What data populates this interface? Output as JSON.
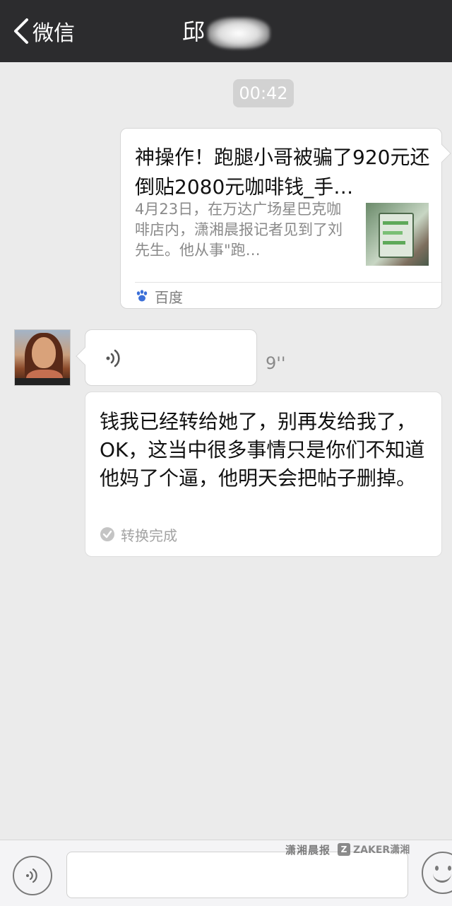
{
  "nav": {
    "back_label": "微信",
    "title": "邱"
  },
  "timestamp": "00:42",
  "link_card": {
    "title": "神操作！跑腿小哥被骗了920元还倒贴2080元咖啡钱_手…",
    "description": "4月23日，在万达广场星巴克咖啡店内，潇湘晨报记者见到了刘先生。他从事\"跑…",
    "source": "百度"
  },
  "voice_message": {
    "duration": "9''"
  },
  "transcript": {
    "text": "钱我已经转给她了，别再发给我了，OK，这当中很多事情只是你们不知道他妈了个逼，他明天会把帖子删掉。",
    "status": "转换完成"
  },
  "watermark": {
    "left": "潇湘晨报",
    "right": "ZAKER潇湘"
  },
  "colors": {
    "navbar": "#2c2c2e",
    "background": "#ebebeb",
    "bubble": "#ffffff",
    "muted_text": "#8a8a8a"
  }
}
